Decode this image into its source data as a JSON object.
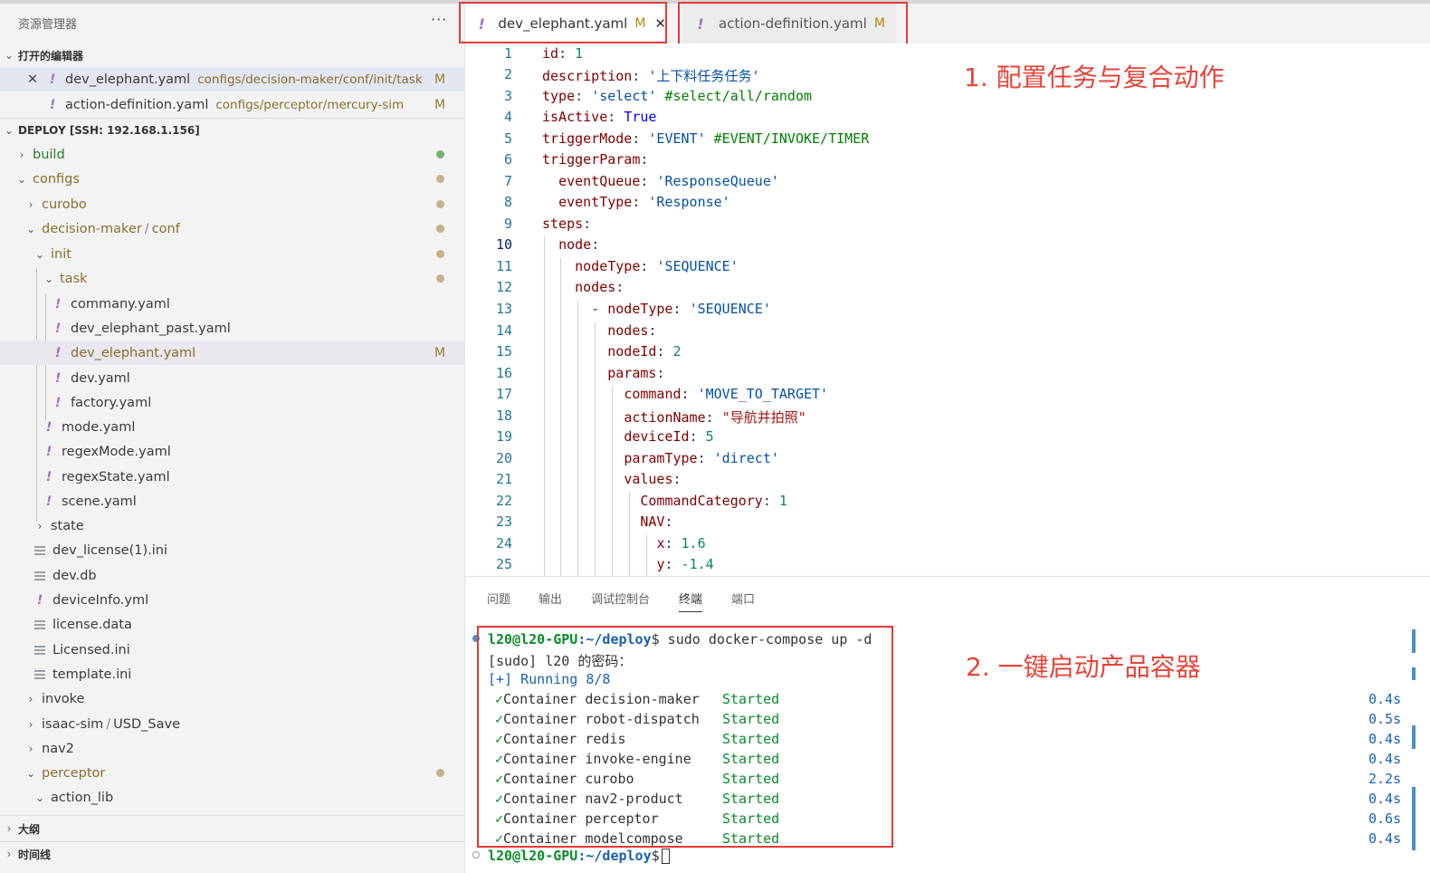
{
  "explorer": {
    "title": "资源管理器",
    "more": "···",
    "open_editors_label": "打开的编辑器",
    "open_editors": [
      {
        "name": "dev_elephant.yaml",
        "path": "configs/decision-maker/conf/init/task",
        "status": "M"
      },
      {
        "name": "action-definition.yaml",
        "path": "configs/perceptor/mercury-sim",
        "status": "M"
      }
    ],
    "workspace_label": "DEPLOY [SSH: 192.168.1.156]",
    "tree": {
      "build": "build",
      "configs": "configs",
      "curobo": "curobo",
      "decision_maker": "decision-maker",
      "slash": "/",
      "conf": "conf",
      "init": "init",
      "task": "task",
      "commany": "commany.yaml",
      "dev_elephant_past": "dev_elephant_past.yaml",
      "dev_elephant": "dev_elephant.yaml",
      "dev_elephant_status": "M",
      "dev": "dev.yaml",
      "factory": "factory.yaml",
      "mode": "mode.yaml",
      "regexMode": "regexMode.yaml",
      "regexState": "regexState.yaml",
      "scene": "scene.yaml",
      "state": "state",
      "dev_license": "dev_license(1).ini",
      "dev_db": "dev.db",
      "deviceInfo": "deviceInfo.yml",
      "license_data": "license.data",
      "Licensed": "Licensed.ini",
      "template": "template.ini",
      "invoke": "invoke",
      "isaac_sim": "isaac-sim",
      "usd_save": "USD_Save",
      "nav2": "nav2",
      "perceptor": "perceptor",
      "action_lib": "action_lib"
    },
    "outline_label": "大纲",
    "timeline_label": "时间线"
  },
  "tabs": [
    {
      "name": "dev_elephant.yaml",
      "status": "M",
      "close": "✕"
    },
    {
      "name": "action-definition.yaml",
      "status": "M"
    }
  ],
  "editor": {
    "line_numbers": [
      "1",
      "2",
      "3",
      "4",
      "5",
      "6",
      "7",
      "8",
      "9",
      "10",
      "11",
      "12",
      "13",
      "14",
      "15",
      "16",
      "17",
      "18",
      "19",
      "20",
      "21",
      "22",
      "23",
      "24",
      "25"
    ],
    "tok": {
      "id": "id",
      "one": "1",
      "description": "description",
      "desc_val": "'上下料任务任务'",
      "type": "type",
      "type_val": "'select'",
      "type_cmt": "#select/all/random",
      "isActive": "isActive",
      "true_val": "True",
      "triggerMode": "triggerMode",
      "tm_val": "'EVENT'",
      "tm_cmt": "#EVENT/INVOKE/TIMER",
      "triggerParam": "triggerParam",
      "eventQueue": "eventQueue",
      "eq_val": "'ResponseQueue'",
      "eventType": "eventType",
      "et_val": "'Response'",
      "steps": "steps",
      "node": "node",
      "nodeType": "nodeType",
      "seq": "'SEQUENCE'",
      "nodes": "nodes",
      "dash": "- ",
      "nodeId": "nodeId",
      "two": "2",
      "params": "params",
      "command": "command",
      "cmd_val": "'MOVE_TO_TARGET'",
      "actionName": "actionName",
      "an_val": "\"导航并拍照\"",
      "deviceId": "deviceId",
      "five": "5",
      "paramType": "paramType",
      "pt_val": "'direct'",
      "values": "values",
      "CommandCategory": "CommandCategory",
      "NAV": "NAV",
      "x": "x",
      "x_val": "1.6",
      "y": "y",
      "y_val": "-1.4",
      "colon": ": ",
      "colon_end": ":"
    },
    "annotation": "1. 配置任务与复合动作"
  },
  "panel": {
    "tabs": [
      "问题",
      "输出",
      "调试控制台",
      "终端",
      "端口"
    ],
    "active_tab": "终端",
    "prompt": "l20@l20-GPU",
    "cwd": ":~/deploy",
    "dollar": "$",
    "command": " sudo docker-compose up -d",
    "sudo_line": "[sudo] l20 的密码：",
    "running": "[+] Running 8/8",
    "check": "✓",
    "container_word": "Container",
    "containers": [
      {
        "name": "decision-maker",
        "status": "Started",
        "time": "0.4s"
      },
      {
        "name": "robot-dispatch",
        "status": "Started",
        "time": "0.5s"
      },
      {
        "name": "redis",
        "status": "Started",
        "time": "0.4s"
      },
      {
        "name": "invoke-engine",
        "status": "Started",
        "time": "0.4s"
      },
      {
        "name": "curobo",
        "status": "Started",
        "time": "2.2s"
      },
      {
        "name": "nav2-product",
        "status": "Started",
        "time": "0.4s"
      },
      {
        "name": "perceptor",
        "status": "Started",
        "time": "0.6s"
      },
      {
        "name": "modelcompose",
        "status": "Started",
        "time": "0.4s"
      }
    ],
    "annotation": "2. 一键启动产品容器"
  },
  "colors": {
    "accent_red": "#e53935",
    "yaml_icon": "#a074c4",
    "modified": "#b8860b",
    "terminal_green": "#0b8a2c"
  }
}
